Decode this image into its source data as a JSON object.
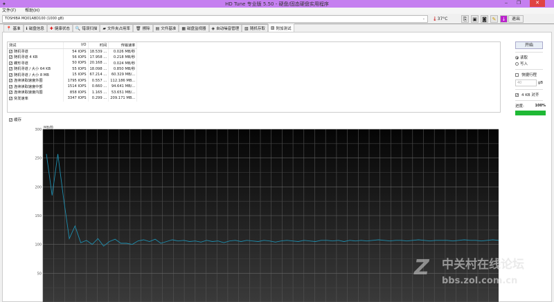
{
  "window": {
    "title": "HD Tune 专业版 5.50 - 硬盘/固态硬盘实用程序",
    "minimize": "‒",
    "restore": "❐",
    "close": "✕"
  },
  "menu": [
    {
      "label": "文件(F)"
    },
    {
      "label": "帮助(H)"
    }
  ],
  "drive": {
    "selected": "TOSHIBA MQ01ABD100 (1000 gB)",
    "temperature": "37°C"
  },
  "toolbar": {
    "exit_label": "退出",
    "icons": [
      "copy-icon",
      "save-icon",
      "camera-icon",
      "options-icon",
      "download-icon"
    ]
  },
  "tabs": [
    {
      "label": "基准",
      "icon": "pin-icon"
    },
    {
      "label": "磁盘信息",
      "icon": "info-icon"
    },
    {
      "label": "健康状态",
      "icon": "health-cross-icon"
    },
    {
      "label": "错误扫描",
      "icon": "magnifier-icon"
    },
    {
      "label": "文件夹占用率",
      "icon": "folder-icon"
    },
    {
      "label": "擦除",
      "icon": "trash-icon"
    },
    {
      "label": "文件基准",
      "icon": "file-benchmark-icon"
    },
    {
      "label": "磁盘监视器",
      "icon": "monitor-icon"
    },
    {
      "label": "自动噪音管理",
      "icon": "speaker-icon"
    },
    {
      "label": "随机存取",
      "icon": "random-access-icon"
    },
    {
      "label": "附加测试",
      "icon": "extra-tests-icon",
      "active": true
    }
  ],
  "results": {
    "headers": [
      "测试",
      "I/O",
      "时间",
      "传输速率"
    ],
    "rows": [
      {
        "test": "随机寻道",
        "io": "54 IOPS",
        "time": "18.539 ...",
        "rate": "0.026 MB/秒"
      },
      {
        "test": "随机寻道 4 KB",
        "io": "56 IOPS",
        "time": "17.958 ...",
        "rate": "0.218 MB/秒"
      },
      {
        "test": "蝶形寻道",
        "io": "50 IOPS",
        "time": "20.168 ...",
        "rate": "0.024 MB/秒"
      },
      {
        "test": "随机寻道 / 大小 64 KB",
        "io": "55 IOPS",
        "time": "18.098 ...",
        "rate": "0.850 MB/秒"
      },
      {
        "test": "随机寻道 / 大小 8 MB",
        "io": "15 IOPS",
        "time": "67.214 ...",
        "rate": "60.329 MB/..."
      },
      {
        "test": "连续读取速度外圈",
        "io": "1795 IOPS",
        "time": "0.557 ...",
        "rate": "112.186 MB..."
      },
      {
        "test": "连续读取速度中部",
        "io": "1514 IOPS",
        "time": "0.660 ...",
        "rate": "94.641 MB/..."
      },
      {
        "test": "连续读取速度内圈",
        "io": "858 IOPS",
        "time": "1.165 ...",
        "rate": "53.651 MB/..."
      },
      {
        "test": "突发速率",
        "io": "3347 IOPS",
        "time": "0.299 ...",
        "rate": "209.171 MB..."
      }
    ]
  },
  "side": {
    "start_label": "开始",
    "read_label": "读取",
    "write_label": "写入",
    "mode": "read",
    "short_stroke_label": "快捷行程",
    "short_stroke_checked": false,
    "short_stroke_value": "40",
    "short_stroke_unit": "gB",
    "align_label": "4 KB 对齐",
    "align_checked": true,
    "progress_label": "进度:",
    "progress_value": "100%",
    "progress_percent": 100,
    "progress_color": "#1fb935"
  },
  "cache_label": "缓存",
  "chart_data": {
    "type": "line",
    "ylabel": "MB/秒",
    "ylim": [
      0,
      300
    ],
    "yticks": [
      50,
      100,
      150,
      200,
      250,
      300
    ],
    "grid": true,
    "line_color": "#1e8fb0",
    "values": [
      257,
      185,
      257,
      180,
      110,
      132,
      103,
      107,
      100,
      110,
      97,
      105,
      109,
      102,
      102,
      100,
      106,
      108,
      105,
      109,
      102,
      105,
      108,
      106,
      107,
      105,
      106,
      104,
      107,
      105,
      106,
      103,
      106,
      107,
      105,
      107,
      106,
      105,
      107,
      106,
      104,
      106,
      107,
      106,
      105,
      107,
      106,
      105,
      107,
      107,
      106,
      107,
      105,
      107,
      106,
      107,
      106,
      107,
      108,
      107,
      106,
      107,
      107,
      106,
      107,
      108,
      107,
      106,
      107,
      107,
      107,
      106,
      107,
      108,
      107,
      107,
      106,
      107,
      108,
      107
    ]
  }
}
